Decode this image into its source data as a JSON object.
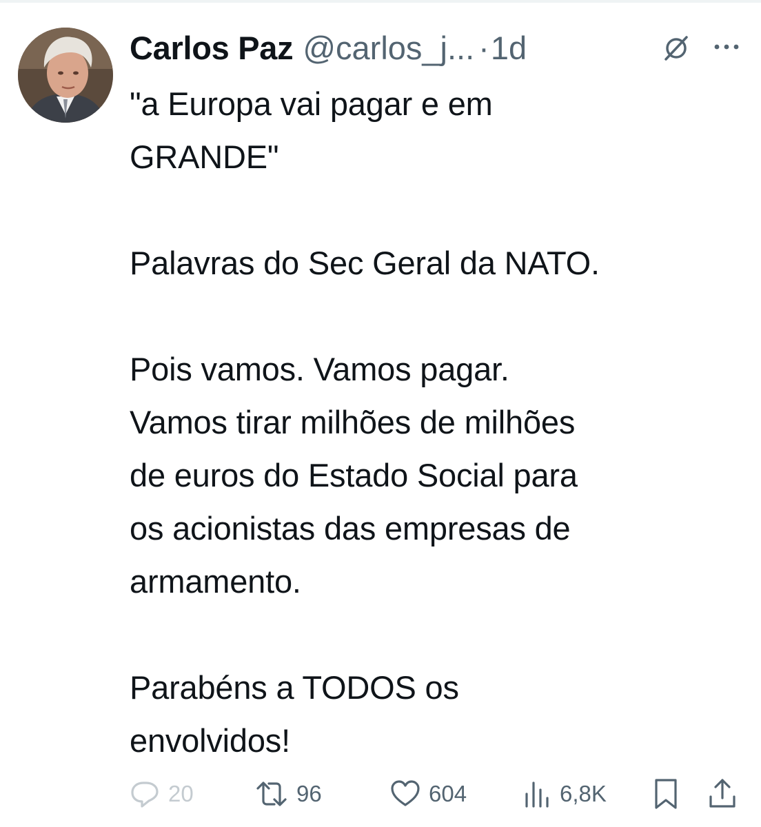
{
  "author": {
    "name": "Carlos Paz",
    "handle": "@carlos_j...",
    "separator": "·",
    "timestamp": "1d"
  },
  "icons": {
    "grok": "grok-icon",
    "more": "more-icon",
    "reply": "reply-icon",
    "retweet": "retweet-icon",
    "like": "heart-icon",
    "views": "views-icon",
    "bookmark": "bookmark-icon",
    "share": "share-icon"
  },
  "tweet": {
    "text": "\"a Europa vai pagar e em\nGRANDE\"\n\nPalavras do Sec Geral da NATO.\n\nPois vamos. Vamos pagar.\nVamos tirar milhões de milhões\nde euros do Estado Social para\nos acionistas das empresas de\narmamento.\n\nParabéns a TODOS os\nenvolvidos!"
  },
  "actions": {
    "replies": "20",
    "retweets": "96",
    "likes": "604",
    "views": "6,8K"
  },
  "colors": {
    "text": "#0f1419",
    "secondary": "#536471",
    "disabled": "#c4cbd0",
    "background": "#ffffff"
  }
}
